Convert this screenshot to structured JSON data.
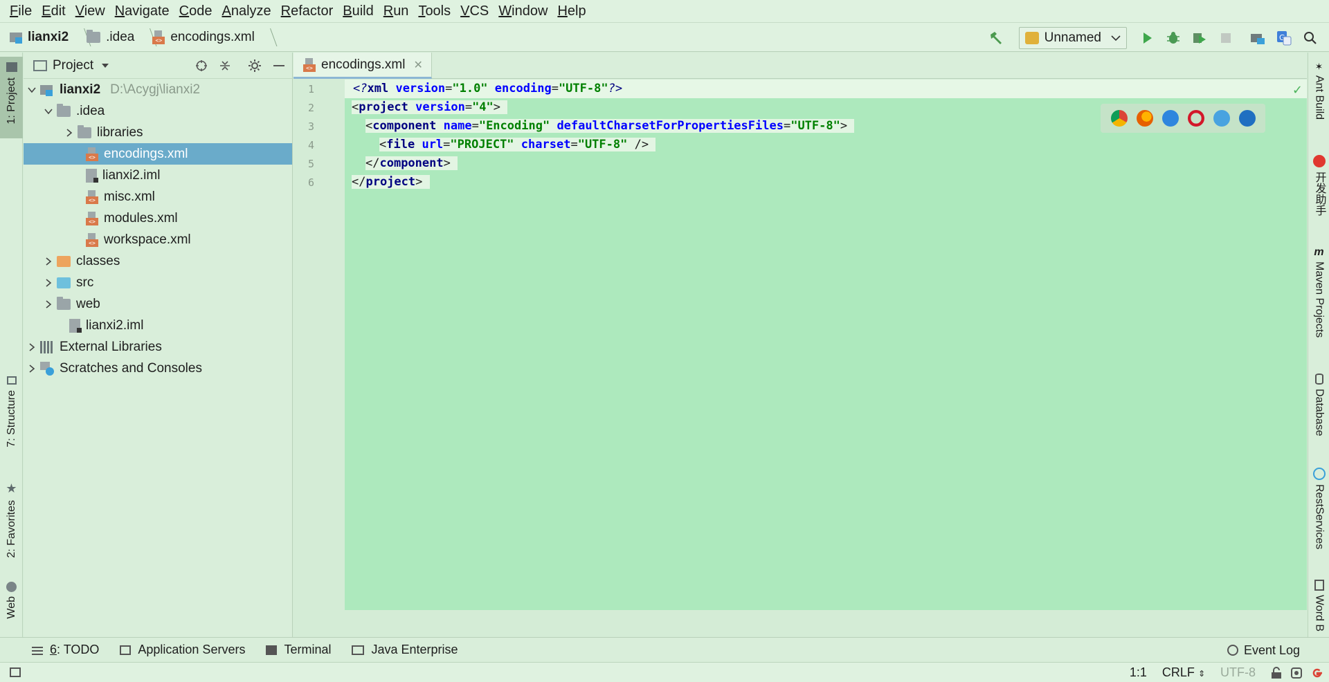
{
  "menu": [
    "File",
    "Edit",
    "View",
    "Navigate",
    "Code",
    "Analyze",
    "Refactor",
    "Build",
    "Run",
    "Tools",
    "VCS",
    "Window",
    "Help"
  ],
  "breadcrumb": {
    "project": "lianxi2",
    "folder": ".idea",
    "file": "encodings.xml"
  },
  "toolbar": {
    "run_config": "Unnamed"
  },
  "left_tabs": {
    "project": "1: Project",
    "structure": "7: Structure",
    "favorites": "2: Favorites",
    "web": "Web"
  },
  "right_tabs": {
    "ant": "Ant Build",
    "kaifa": "开发助手",
    "maven": "Maven Projects",
    "database": "Database",
    "rest": "RestServices",
    "word": "Word B"
  },
  "project_panel": {
    "title": "Project",
    "root_name": "lianxi2",
    "root_path": "D:\\Acygj\\lianxi2",
    "idea": ".idea",
    "libraries": "libraries",
    "encodings": "encodings.xml",
    "lianxi2_iml_inner": "lianxi2.iml",
    "misc": "misc.xml",
    "modules": "modules.xml",
    "workspace": "workspace.xml",
    "classes": "classes",
    "src": "src",
    "web": "web",
    "lianxi2_iml": "lianxi2.iml",
    "external": "External Libraries",
    "scratches": "Scratches and Consoles"
  },
  "editor": {
    "tab": "encodings.xml",
    "line_numbers": [
      "1",
      "2",
      "3",
      "4",
      "5",
      "6"
    ]
  },
  "code": {
    "l1": {
      "open": "<?",
      "tag": "xml",
      "a1": "version",
      "eq1": "=",
      "v1": "\"1.0\"",
      "a2": "encoding",
      "eq2": "=",
      "v2": "\"UTF-8\"",
      "close": "?>"
    },
    "l2": {
      "open": "<",
      "tag": "project",
      "a1": "version",
      "eq1": "=",
      "v1": "\"4\"",
      "close": ">"
    },
    "l3": {
      "open": "<",
      "tag": "component",
      "a1": "name",
      "eq1": "=",
      "v1": "\"Encoding\"",
      "a2": "defaultCharsetForPropertiesFiles",
      "eq2": "=",
      "v2": "\"UTF-8\"",
      "close": ">"
    },
    "l4": {
      "open": "<",
      "tag": "file",
      "a1": "url",
      "eq1": "=",
      "v1": "\"PROJECT\"",
      "a2": "charset",
      "eq2": "=",
      "v2": "\"UTF-8\"",
      "close": "/>"
    },
    "l5": {
      "open": "</",
      "tag": "component",
      "close": ">"
    },
    "l6": {
      "open": "</",
      "tag": "project",
      "close": ">"
    }
  },
  "bottom_tools": {
    "todo_num": "6",
    "todo": ": TODO",
    "app_servers": "Application Servers",
    "terminal": "Terminal",
    "java_ee": "Java Enterprise",
    "event_log": "Event Log"
  },
  "status": {
    "position": "1:1",
    "line_sep": "CRLF",
    "encoding": "UTF-8"
  }
}
